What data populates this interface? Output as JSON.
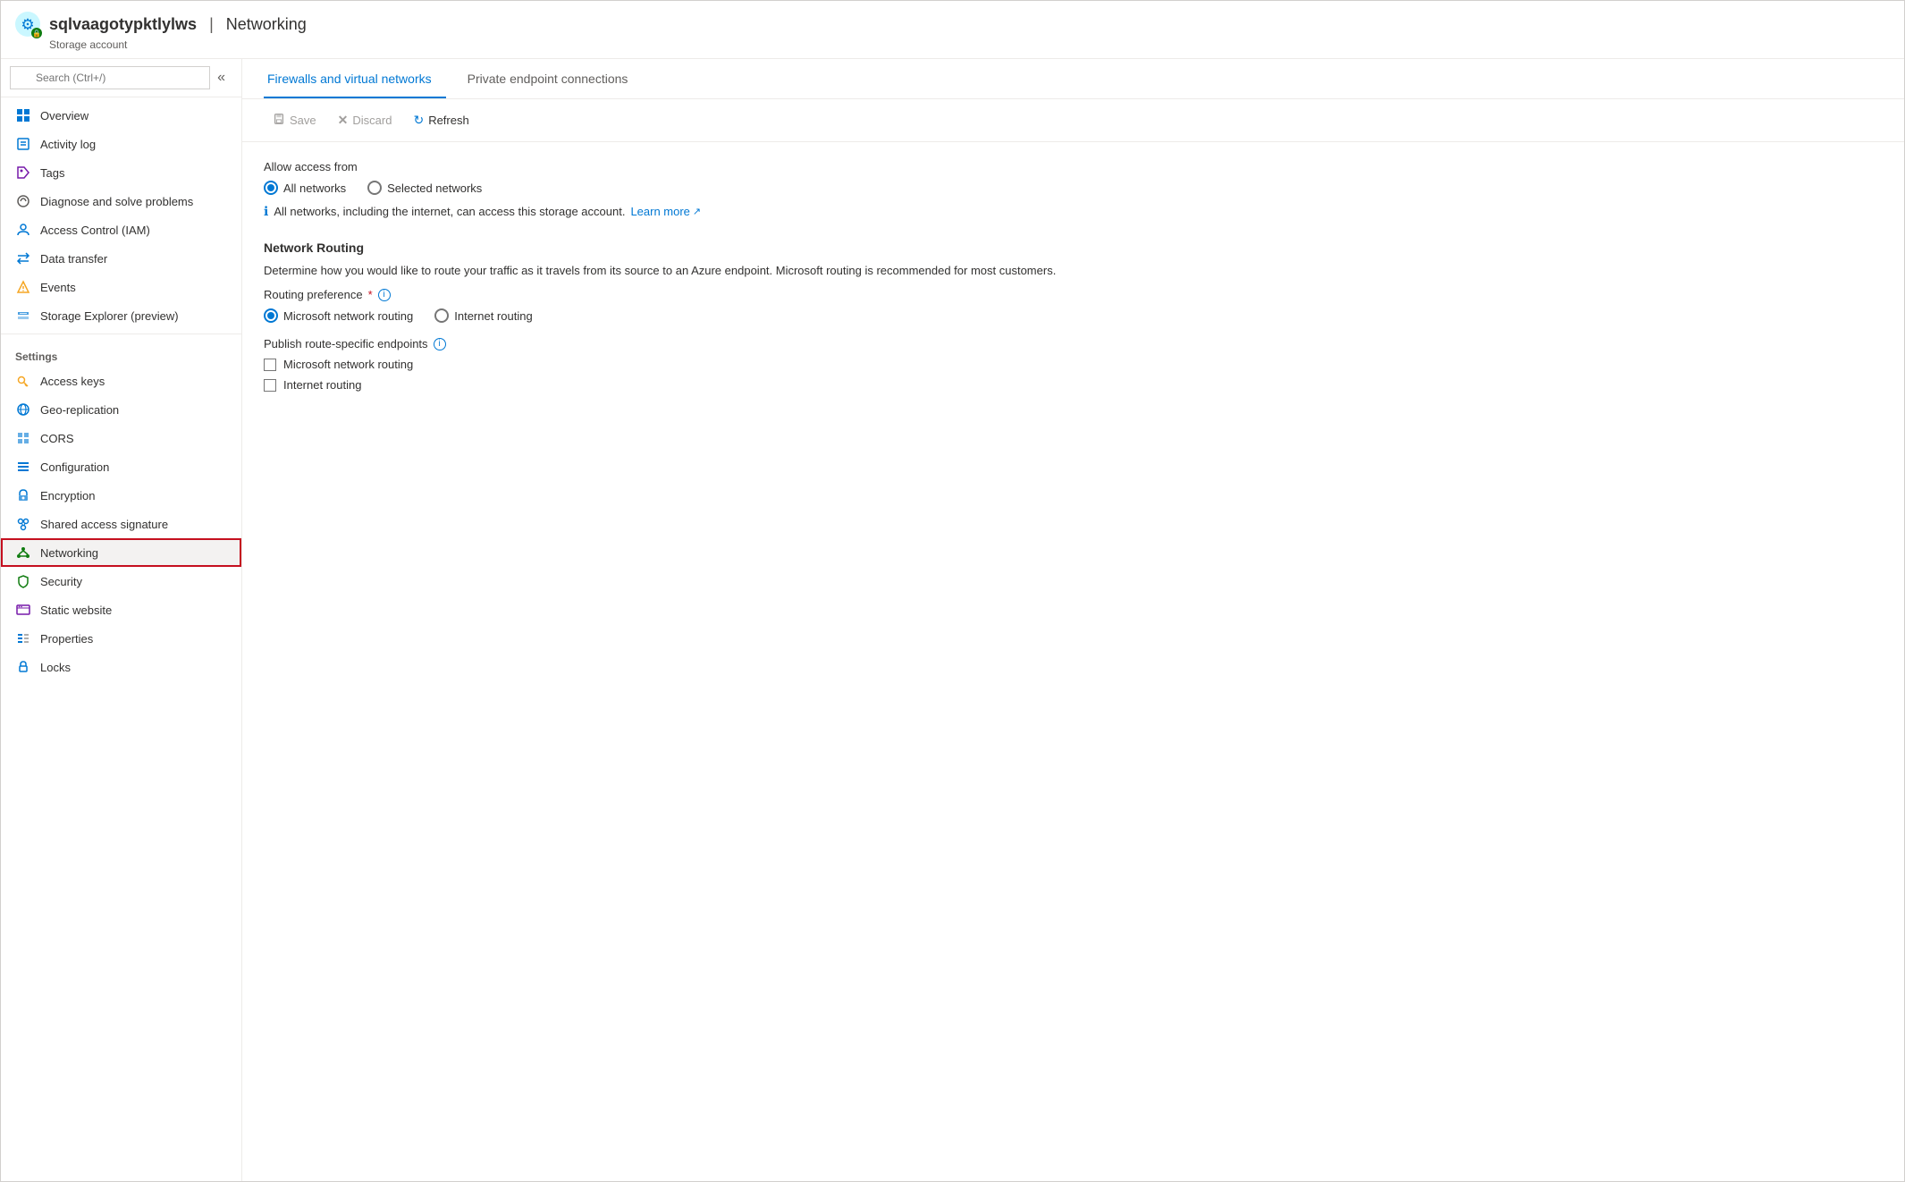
{
  "header": {
    "resource_name": "sqlvaagotypktlylws",
    "separator": "|",
    "section": "Networking",
    "subtitle": "Storage account"
  },
  "search": {
    "placeholder": "Search (Ctrl+/)"
  },
  "sidebar": {
    "top_items": [
      {
        "id": "overview",
        "label": "Overview",
        "icon": "overview"
      },
      {
        "id": "activity-log",
        "label": "Activity log",
        "icon": "activity"
      },
      {
        "id": "tags",
        "label": "Tags",
        "icon": "tags"
      },
      {
        "id": "diagnose",
        "label": "Diagnose and solve problems",
        "icon": "diagnose"
      },
      {
        "id": "access-control",
        "label": "Access Control (IAM)",
        "icon": "iam"
      },
      {
        "id": "data-transfer",
        "label": "Data transfer",
        "icon": "data-transfer"
      },
      {
        "id": "events",
        "label": "Events",
        "icon": "events"
      },
      {
        "id": "storage-explorer",
        "label": "Storage Explorer (preview)",
        "icon": "storage-explorer"
      }
    ],
    "settings_section": "Settings",
    "settings_items": [
      {
        "id": "access-keys",
        "label": "Access keys",
        "icon": "key"
      },
      {
        "id": "geo-replication",
        "label": "Geo-replication",
        "icon": "geo"
      },
      {
        "id": "cors",
        "label": "CORS",
        "icon": "cors"
      },
      {
        "id": "configuration",
        "label": "Configuration",
        "icon": "config"
      },
      {
        "id": "encryption",
        "label": "Encryption",
        "icon": "encryption"
      },
      {
        "id": "shared-access-sig",
        "label": "Shared access signature",
        "icon": "shared"
      },
      {
        "id": "networking",
        "label": "Networking",
        "icon": "networking",
        "active": true
      },
      {
        "id": "security",
        "label": "Security",
        "icon": "security"
      },
      {
        "id": "static-website",
        "label": "Static website",
        "icon": "static"
      },
      {
        "id": "properties",
        "label": "Properties",
        "icon": "properties"
      },
      {
        "id": "locks",
        "label": "Locks",
        "icon": "locks"
      }
    ]
  },
  "tabs": [
    {
      "id": "firewalls",
      "label": "Firewalls and virtual networks",
      "active": true
    },
    {
      "id": "private-endpoints",
      "label": "Private endpoint connections",
      "active": false
    }
  ],
  "toolbar": {
    "save_label": "Save",
    "discard_label": "Discard",
    "refresh_label": "Refresh"
  },
  "content": {
    "allow_access_label": "Allow access from",
    "all_networks_label": "All networks",
    "selected_networks_label": "Selected networks",
    "info_text": "All networks, including the internet, can access this storage account.",
    "learn_more_label": "Learn more",
    "network_routing_title": "Network Routing",
    "network_routing_desc": "Determine how you would like to route your traffic as it travels from its source to an Azure endpoint. Microsoft routing is recommended for most customers.",
    "routing_preference_label": "Routing preference",
    "microsoft_routing_label": "Microsoft network routing",
    "internet_routing_label": "Internet routing",
    "publish_endpoints_label": "Publish route-specific endpoints",
    "publish_microsoft_label": "Microsoft network routing",
    "publish_internet_label": "Internet routing"
  }
}
